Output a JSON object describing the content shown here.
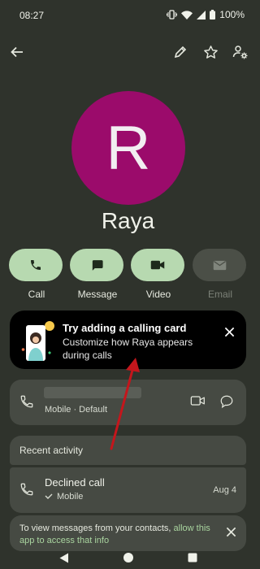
{
  "status_bar": {
    "time": "08:27",
    "battery": "100%"
  },
  "icons": {
    "back": "back-arrow-icon",
    "edit": "pencil-icon",
    "favorite": "star-icon",
    "settings": "contact-settings-icon",
    "phone": "phone-icon",
    "message": "chat-bubble-icon",
    "video": "video-camera-icon",
    "email": "email-icon",
    "close": "close-icon"
  },
  "contact": {
    "initial": "R",
    "name": "Raya",
    "avatar_color": "#9b0b6b"
  },
  "actions": [
    {
      "label": "Call",
      "enabled": true
    },
    {
      "label": "Message",
      "enabled": true
    },
    {
      "label": "Video",
      "enabled": true
    },
    {
      "label": "Email",
      "enabled": false
    }
  ],
  "calling_card": {
    "title": "Try adding a calling card",
    "subtitle": "Customize how Raya appears during calls"
  },
  "phone_entry": {
    "number": "",
    "type": "Mobile · Default"
  },
  "recent_activity": {
    "header": "Recent activity",
    "items": [
      {
        "title": "Declined call",
        "subtitle": "Mobile",
        "date": "Aug 4"
      }
    ]
  },
  "permission_banner": {
    "text": "To view messages from your contacts, ",
    "link": "allow this app to access that info"
  },
  "colors": {
    "accent": "#b7d9b0",
    "background": "#2f332c",
    "card": "#464a43",
    "link": "#a9d49f",
    "annotation": "#c4161c"
  }
}
